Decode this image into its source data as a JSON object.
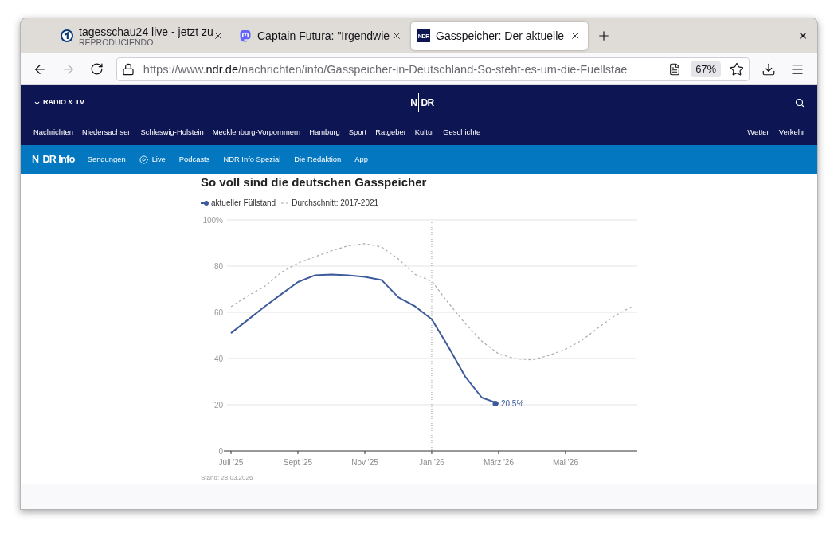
{
  "window": {
    "tabs": [
      {
        "kind": "circle",
        "title": "tagesschau24 live - jetzt zu",
        "subtitle": "REPRODUCIENDO",
        "selected": false
      },
      {
        "kind": "bubble",
        "title": "Captain Futura: \"Irgendwie",
        "selected": false
      },
      {
        "kind": "square",
        "favicon_text": "NDR",
        "title": "Gasspeicher: Der aktuelle",
        "selected": true
      }
    ]
  },
  "toolbar": {
    "back_disabled": false,
    "forward_disabled": true,
    "url": {
      "scheme": "https://www.",
      "domain": "ndr.de",
      "path": "/nachrichten/info/Gasspeicher-in-Deutschland-So-steht-es-um-die-Fuellstae"
    },
    "zoom": "67%"
  },
  "site_header": {
    "menu_label": "RADIO & TV",
    "logo": "NDR",
    "nav": [
      "Nachrichten",
      "Niedersachsen",
      "Schleswig-Holstein",
      "Mecklenburg-Vorpommern",
      "Hamburg",
      "Sport",
      "Ratgeber",
      "Kultur",
      "Geschichte"
    ],
    "nav_right": [
      "Wetter",
      "Verkehr"
    ]
  },
  "subnav": {
    "logo": "NDR Info",
    "items": [
      {
        "kind": "link",
        "label": "Sendungen"
      },
      {
        "kind": "live",
        "label": "Live"
      },
      {
        "kind": "link",
        "label": "Podcasts"
      },
      {
        "kind": "link",
        "label": "NDR Info Spezial"
      },
      {
        "kind": "link",
        "label": "Die Redaktion"
      },
      {
        "kind": "link",
        "label": "App"
      }
    ]
  },
  "article": {
    "chart": {
      "chart_data": {
        "type": "line",
        "title": "So voll sind die deutschen Gasspeicher",
        "categories": [
          "Juli '25",
          null,
          null,
          null,
          "Sept '25",
          null,
          null,
          null,
          "Nov '25",
          null,
          null,
          null,
          "Jan '26",
          null,
          null,
          null,
          "März '26",
          null,
          null,
          null,
          "Mai '26",
          null,
          null,
          null,
          null
        ],
        "series": [
          {
            "name": "aktueller Füllstand",
            "color": "#3d5a9a",
            "line_style": "solid",
            "values": [
              51.0,
              56.7,
              62.4,
              67.8,
              73.1,
              76.0,
              76.4,
              76.0,
              75.3,
              74.0,
              66.5,
              62.6,
              57.0,
              45.0,
              32.2,
              23.1,
              20.5,
              null,
              null,
              null,
              null,
              null,
              null,
              null,
              null
            ]
          },
          {
            "name": "Durchschnitt: 2017-2021",
            "color": "#aaaaaa",
            "line_style": "dashed",
            "values": [
              62.4,
              67.1,
              71.1,
              77.3,
              81.3,
              84.0,
              86.6,
              88.8,
              89.7,
              88.3,
              83.1,
              76.4,
              73.5,
              64.0,
              55.2,
              47.5,
              42.0,
              39.9,
              39.4,
              41.3,
              44.0,
              48.0,
              53.5,
              58.7,
              62.6
            ]
          }
        ],
        "ylim": [
          0,
          100
        ],
        "yticks": [
          0,
          20,
          40,
          60,
          80,
          {
            "value": 100,
            "label": "100%"
          }
        ],
        "grid": true,
        "ref_lines": [
          {
            "axis": "x",
            "value": "Jan '26"
          }
        ],
        "annotations": [
          {
            "x": "März '26",
            "y": 20.5,
            "text": "20,5%"
          }
        ]
      }
    },
    "footnote": "Stand: 28.03.2026"
  }
}
